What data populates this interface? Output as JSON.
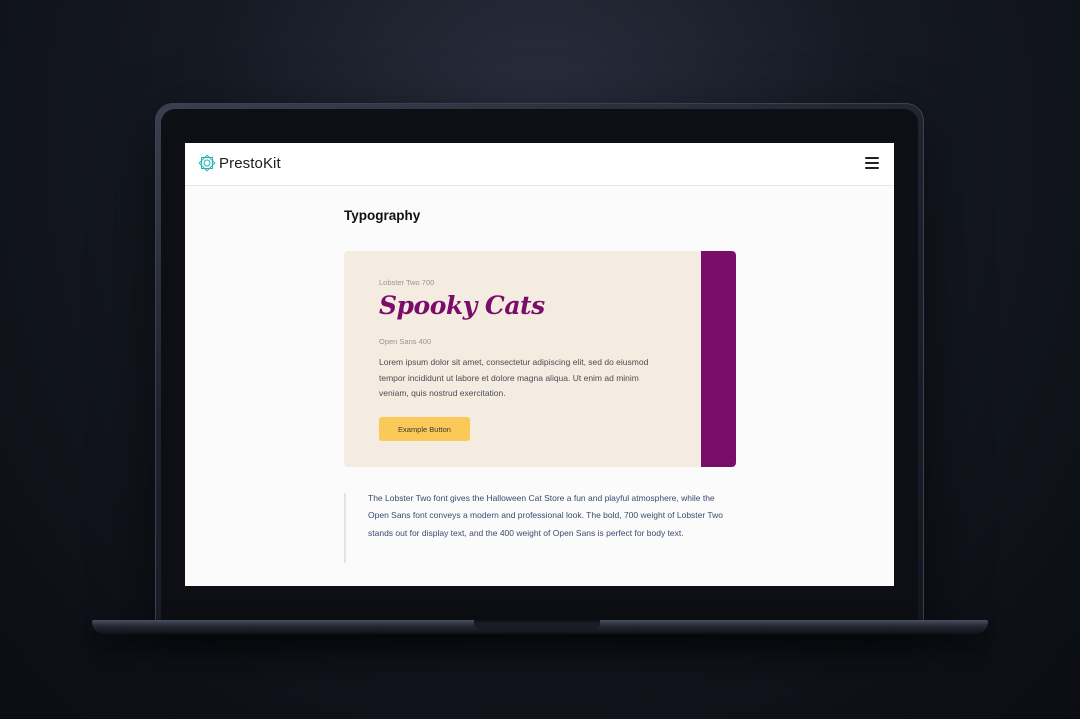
{
  "app": {
    "logo_text": "PrestoKit",
    "accent_color": "#1fb5b0"
  },
  "header": {
    "menu_icon": "hamburger-menu-icon"
  },
  "main": {
    "title": "Typography",
    "card": {
      "display_font_label": "Lobster Two 700",
      "display_text": "Spooky Cats",
      "body_font_label": "Open Sans 400",
      "body_text": "Lorem ipsum dolor sit amet, consectetur adipiscing elit, sed do eiusmod tempor incididunt ut labore et dolore magna aliqua. Ut enim ad minim veniam, quis nostrud exercitation.",
      "button_label": "Example Button",
      "background_color": "#f4ece0",
      "stripe_color": "#7a0d6a",
      "button_color": "#fbc957"
    },
    "description": "The Lobster Two font gives the Halloween Cat Store a fun and playful atmosphere, while the Open Sans font conveys a modern and professional look. The bold, 700 weight of Lobster Two stands out for display text, and the 400 weight of Open Sans is perfect for body text."
  }
}
